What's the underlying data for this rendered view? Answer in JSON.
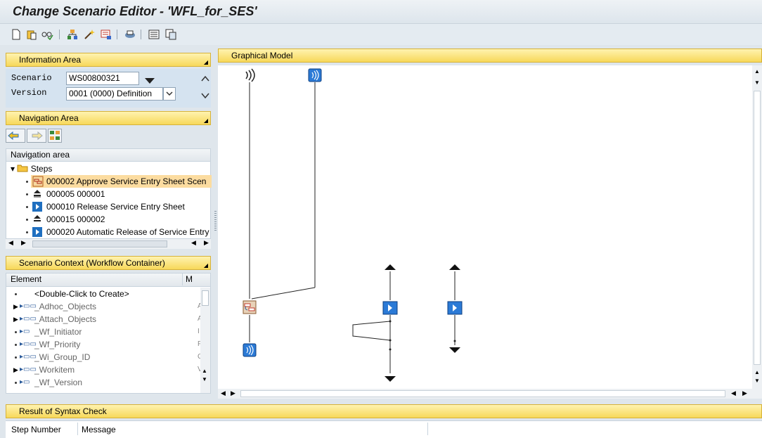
{
  "window": {
    "title": "Change Scenario Editor - 'WFL_for_SES'"
  },
  "toolbar": {
    "icons": [
      "new-document-icon",
      "paste-icon",
      "glasses-check-icon",
      "tree-structure-icon",
      "magic-wand-icon",
      "filter-icon",
      "print-icon",
      "list-icon",
      "copy-icon"
    ]
  },
  "info_area": {
    "header": "Information Area",
    "scenario_label": "Scenario",
    "scenario_value": "WS00800321",
    "version_label": "Version",
    "version_value": "0001 (0000) Definition"
  },
  "navigation_area": {
    "header": "Navigation Area",
    "list_header": "Navigation area",
    "root": "Steps",
    "steps": [
      {
        "label": "000002 Approve Service Entry Sheet Scen",
        "icon": "approve-step-icon",
        "selected": true
      },
      {
        "label": "000005 000001",
        "icon": "fork-icon"
      },
      {
        "label": "000010 Release Service Entry Sheet",
        "icon": "activity-icon"
      },
      {
        "label": "000015 000002",
        "icon": "fork-icon"
      },
      {
        "label": "000020 Automatic Release of Service Entry",
        "icon": "activity-icon"
      }
    ]
  },
  "scenario_context": {
    "header": "Scenario Context (Workflow Container)",
    "col_element": "Element",
    "col_m": "M",
    "items": [
      {
        "label": "<Double-Click to Create>",
        "m": ""
      },
      {
        "label": "_Adhoc_Objects",
        "m": "A"
      },
      {
        "label": "_Attach_Objects",
        "m": "A"
      },
      {
        "label": "_Wf_Initiator",
        "m": "I"
      },
      {
        "label": "_Wf_Priority",
        "m": "F"
      },
      {
        "label": "_Wi_Group_ID",
        "m": "C"
      },
      {
        "label": "_Workitem",
        "m": "V"
      },
      {
        "label": "_Wf_Version",
        "m": ""
      }
    ]
  },
  "graphical_model": {
    "header": "Graphical Model"
  },
  "syntax_check": {
    "header": "Result of Syntax Check",
    "col_step": "Step Number",
    "col_message": "Message"
  },
  "colors": {
    "header_yellow": "#f7d85a",
    "selection": "#fcdca0",
    "node_blue": "#2b7ad6"
  }
}
